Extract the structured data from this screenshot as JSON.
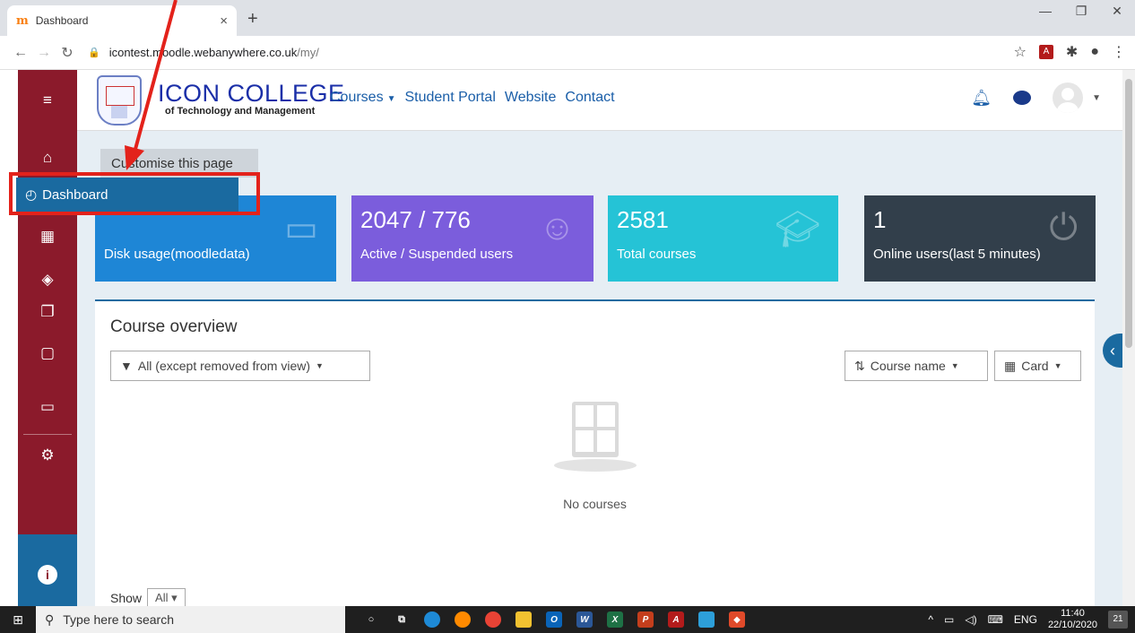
{
  "browser": {
    "tab_title": "Dashboard",
    "tab_favicon": "m",
    "url_host": "icontest.moodle.webanywhere.co.uk",
    "url_path": "/my/"
  },
  "header": {
    "logo_main": "ICON COLLEGE",
    "logo_sub": "of Technology and Management",
    "nav": [
      "Courses",
      "Student Portal",
      "Website",
      "Contact"
    ]
  },
  "page": {
    "customise_label": "Customise this page"
  },
  "stats": [
    {
      "value": "2047 / 776",
      "label": "Active / Suspended users",
      "icon": "users-icon"
    },
    {
      "value": "2581",
      "label": "Total courses",
      "icon": "graduation-cap-icon"
    },
    {
      "value": "1",
      "label": "Online users(last 5 minutes)",
      "icon": "plug-icon"
    },
    {
      "label": "Disk usage(moodledata)",
      "icon": "inbox-icon"
    }
  ],
  "course_overview": {
    "title": "Course overview",
    "filter": "All (except removed from view)",
    "sort": "Course name",
    "view": "Card",
    "empty_text": "No courses",
    "show_label": "Show",
    "show_value": "All"
  },
  "highlight": {
    "label": "Dashboard"
  },
  "taskbar": {
    "search_placeholder": "Type here to search",
    "lang": "ENG",
    "time": "11:40",
    "date": "22/10/2020",
    "notifications": "21"
  },
  "colors": {
    "sidebar": "#8b1a2b",
    "accent": "#1a6aa0",
    "highlight_border": "#e3221b"
  }
}
